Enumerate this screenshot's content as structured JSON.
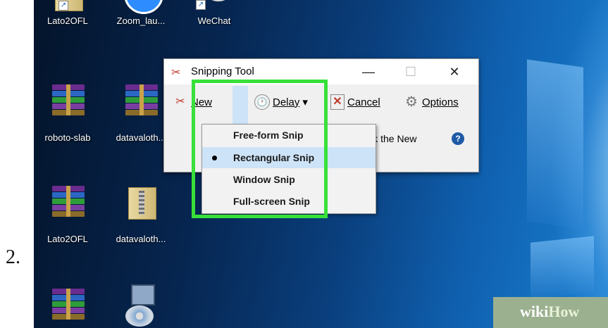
{
  "step_number": "2.",
  "desktop": {
    "icons": [
      {
        "label": "Lato2OFL"
      },
      {
        "label": "Zoom_lau..."
      },
      {
        "label": "WeChat"
      },
      {
        "label": "roboto-slab"
      },
      {
        "label": "datavaloth..."
      },
      {
        "label": "Lato2OFL"
      },
      {
        "label": "datavaloth..."
      }
    ]
  },
  "window": {
    "title": "Snipping Tool",
    "minimize": "—",
    "maximize": "☐",
    "close": "✕",
    "toolbar": {
      "new_label": "New",
      "delay_label": "Delay",
      "cancel_label": "Cancel",
      "options_label": "Options"
    },
    "hint_text": "d or click the New",
    "help_label": "?"
  },
  "new_menu": {
    "items": [
      {
        "label": "Free-form Snip",
        "selected": false
      },
      {
        "label": "Rectangular Snip",
        "selected": true
      },
      {
        "label": "Window Snip",
        "selected": false
      },
      {
        "label": "Full-screen Snip",
        "selected": false
      }
    ]
  },
  "watermark": {
    "part1": "wiki",
    "part2": "How"
  },
  "colors": {
    "highlight": "#38e03a",
    "menu_selected": "#cde3f7"
  }
}
